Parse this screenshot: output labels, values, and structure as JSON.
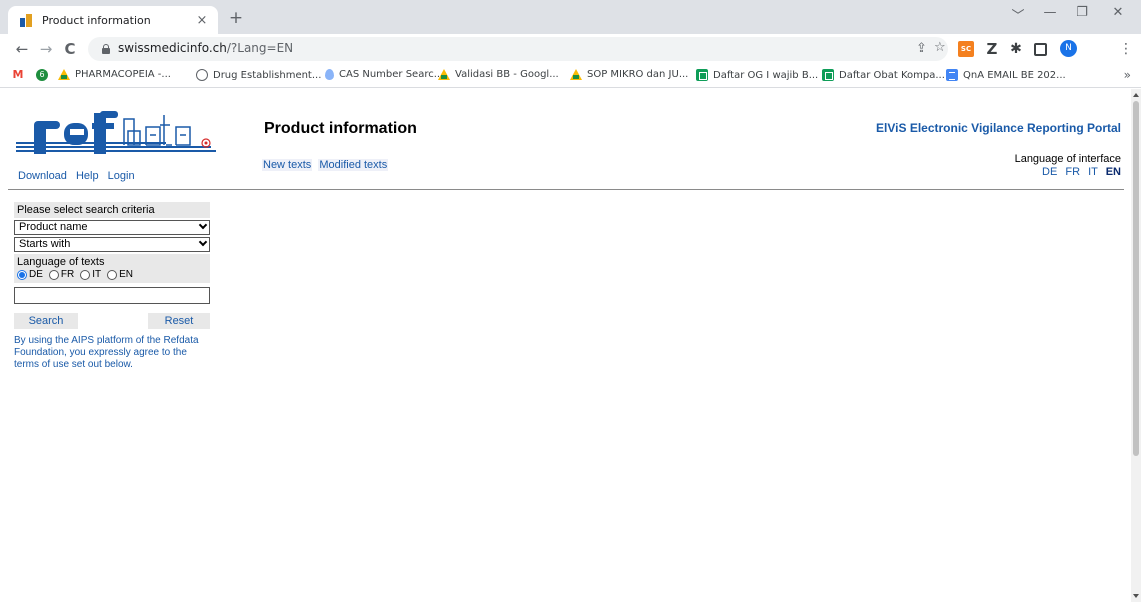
{
  "browser": {
    "tab_title": "Product information",
    "tab_close": "×",
    "new_tab": "+",
    "url_host": "swissmedicinfo.ch",
    "url_path": "/?Lang=EN",
    "window_controls": [
      "﹀",
      "—",
      "❐",
      "✕"
    ],
    "nav": {
      "back": "←",
      "forward": "→",
      "reload": "C"
    },
    "extensions": {
      "sc_label": "SC",
      "z_label": "Z",
      "avatar_label": "N"
    },
    "bookmarks": [
      {
        "label": "",
        "icon": "gmail-icon"
      },
      {
        "label": "",
        "icon": "green-circle-icon"
      },
      {
        "label": "PHARMACOPEIA -...",
        "icon": "drive-icon"
      },
      {
        "label": "Drug Establishment...",
        "icon": "globe-icon"
      },
      {
        "label": "CAS Number Searc...",
        "icon": "drop-icon"
      },
      {
        "label": "Validasi BB - Googl...",
        "icon": "drive-icon"
      },
      {
        "label": "SOP MIKRO dan JU...",
        "icon": "drive-icon"
      },
      {
        "label": "Daftar OG I wajib B...",
        "icon": "sheets-icon"
      },
      {
        "label": "Daftar Obat Kompa...",
        "icon": "sheets-icon"
      },
      {
        "label": "QnA EMAIL BE 202...",
        "icon": "docs-icon"
      }
    ],
    "bookmarks_more": "»"
  },
  "header": {
    "logo_text": "refdata",
    "links": [
      "Download",
      "Help",
      "Login"
    ],
    "page_title": "Product information",
    "sublinks": [
      "New texts",
      "Modified texts"
    ],
    "portal_link": "ElViS Electronic Vigilance Reporting Portal",
    "language_label": "Language of interface",
    "languages": [
      "DE",
      "FR",
      "IT",
      "EN"
    ],
    "active_language": "EN"
  },
  "search": {
    "heading": "Please select search criteria",
    "criteria_select": "Product name",
    "match_select": "Starts with",
    "texts_language_label": "Language of texts",
    "text_languages": [
      "DE",
      "FR",
      "IT",
      "EN"
    ],
    "selected_text_language": "DE",
    "query_value": "",
    "search_button": "Search",
    "reset_button": "Reset",
    "terms": "By using the AIPS platform of the Refdata Foundation, you expressly agree to the terms of use set out below."
  },
  "colors": {
    "link": "#1a5aa8",
    "panel_bg": "#e8e8e8",
    "logo_blue": "#1a5aa8"
  }
}
